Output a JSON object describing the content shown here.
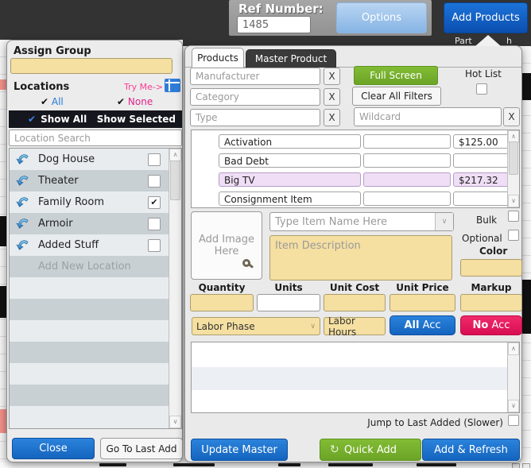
{
  "topbar": {
    "ref_number_label": "Ref Number:",
    "ref_number_value": "1485",
    "options_button": "Options",
    "add_products_button": "Add Products",
    "partial_text_left": "Part",
    "partial_text_right": "h"
  },
  "left_panel": {
    "assign_group_label": "Assign Group",
    "locations_title": "Locations",
    "try_me_label": "Try Me->",
    "all_label": "All",
    "none_label": "None",
    "show_all_label": "Show All",
    "show_selected_label": "Show Selected",
    "search_placeholder": "Location Search",
    "items": [
      {
        "name": "Dog House",
        "checked": false
      },
      {
        "name": "Theater",
        "checked": false
      },
      {
        "name": "Family Room",
        "checked": true
      },
      {
        "name": "Armoir",
        "checked": false
      },
      {
        "name": "Added Stuff",
        "checked": false
      }
    ],
    "add_new_label": "Add New Location",
    "close_button": "Close",
    "go_to_last_add_button": "Go To Last Add"
  },
  "right_panel": {
    "tab_products": "Products",
    "tab_master": "Master Product",
    "manufacturer_placeholder": "Manufacturer",
    "category_placeholder": "Category",
    "type_placeholder": "Type",
    "wildcard_placeholder": "Wildcard",
    "x_label": "X",
    "full_screen_button": "Full Screen",
    "clear_all_filters_button": "Clear All Filters",
    "hot_list_label": "Hot List",
    "products": [
      {
        "name": "Activation",
        "price": "$125.00",
        "highlighted": false
      },
      {
        "name": "Bad Debt",
        "price": "",
        "highlighted": false
      },
      {
        "name": "Big TV",
        "price": "$217.32",
        "highlighted": true
      },
      {
        "name": "Consignment Item",
        "price": "",
        "highlighted": false
      }
    ],
    "add_image_label": "Add Image Here",
    "item_name_placeholder": "Type Item Name Here",
    "bulk_label": "Bulk",
    "optional_label": "Optional",
    "description_placeholder": "Item Description",
    "color_label": "Color",
    "col_quantity": "Quantity",
    "col_units": "Units",
    "col_unit_cost": "Unit Cost",
    "col_unit_price": "Unit Price",
    "col_markup": "Markup",
    "labor_phase_label": "Labor Phase",
    "labor_hours_label": "Labor Hours",
    "all_acc_strong": "All",
    "all_acc_rest": " Acc",
    "no_acc_strong": "No",
    "no_acc_rest": " Acc",
    "jump_label": "Jump to Last Added (Slower)",
    "update_master_button": "Update Master",
    "quick_add_button": "Quick Add",
    "add_refresh_button": "Add & Refresh"
  },
  "icons": {
    "check": "✔",
    "chevron_up": "∧",
    "chevron_down": "∨",
    "refresh": "↻"
  },
  "colors": {
    "accent_blue": "#1566C4",
    "light_blue": "#9CC1EA",
    "green": "#76B12D",
    "crimson": "#E9175C",
    "yellow_field": "#F5DFA1",
    "highlight_lavender": "#F0DEF6",
    "magenta": "#F93C96",
    "link_blue": "#1E78D7",
    "topbar_dark": "#333333"
  }
}
